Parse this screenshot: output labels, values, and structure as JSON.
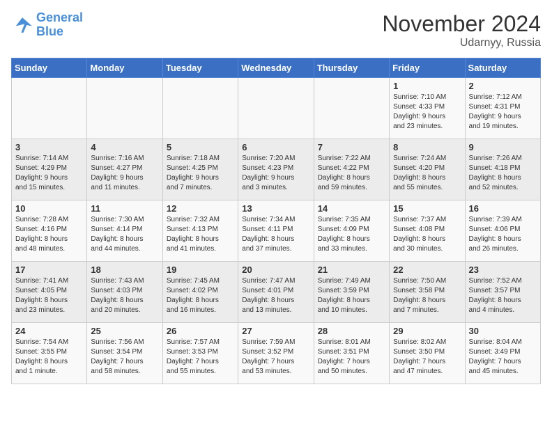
{
  "header": {
    "logo_line1": "General",
    "logo_line2": "Blue",
    "month": "November 2024",
    "location": "Udarnyy, Russia"
  },
  "weekdays": [
    "Sunday",
    "Monday",
    "Tuesday",
    "Wednesday",
    "Thursday",
    "Friday",
    "Saturday"
  ],
  "weeks": [
    [
      {
        "day": "",
        "info": ""
      },
      {
        "day": "",
        "info": ""
      },
      {
        "day": "",
        "info": ""
      },
      {
        "day": "",
        "info": ""
      },
      {
        "day": "",
        "info": ""
      },
      {
        "day": "1",
        "info": "Sunrise: 7:10 AM\nSunset: 4:33 PM\nDaylight: 9 hours\nand 23 minutes."
      },
      {
        "day": "2",
        "info": "Sunrise: 7:12 AM\nSunset: 4:31 PM\nDaylight: 9 hours\nand 19 minutes."
      }
    ],
    [
      {
        "day": "3",
        "info": "Sunrise: 7:14 AM\nSunset: 4:29 PM\nDaylight: 9 hours\nand 15 minutes."
      },
      {
        "day": "4",
        "info": "Sunrise: 7:16 AM\nSunset: 4:27 PM\nDaylight: 9 hours\nand 11 minutes."
      },
      {
        "day": "5",
        "info": "Sunrise: 7:18 AM\nSunset: 4:25 PM\nDaylight: 9 hours\nand 7 minutes."
      },
      {
        "day": "6",
        "info": "Sunrise: 7:20 AM\nSunset: 4:23 PM\nDaylight: 9 hours\nand 3 minutes."
      },
      {
        "day": "7",
        "info": "Sunrise: 7:22 AM\nSunset: 4:22 PM\nDaylight: 8 hours\nand 59 minutes."
      },
      {
        "day": "8",
        "info": "Sunrise: 7:24 AM\nSunset: 4:20 PM\nDaylight: 8 hours\nand 55 minutes."
      },
      {
        "day": "9",
        "info": "Sunrise: 7:26 AM\nSunset: 4:18 PM\nDaylight: 8 hours\nand 52 minutes."
      }
    ],
    [
      {
        "day": "10",
        "info": "Sunrise: 7:28 AM\nSunset: 4:16 PM\nDaylight: 8 hours\nand 48 minutes."
      },
      {
        "day": "11",
        "info": "Sunrise: 7:30 AM\nSunset: 4:14 PM\nDaylight: 8 hours\nand 44 minutes."
      },
      {
        "day": "12",
        "info": "Sunrise: 7:32 AM\nSunset: 4:13 PM\nDaylight: 8 hours\nand 41 minutes."
      },
      {
        "day": "13",
        "info": "Sunrise: 7:34 AM\nSunset: 4:11 PM\nDaylight: 8 hours\nand 37 minutes."
      },
      {
        "day": "14",
        "info": "Sunrise: 7:35 AM\nSunset: 4:09 PM\nDaylight: 8 hours\nand 33 minutes."
      },
      {
        "day": "15",
        "info": "Sunrise: 7:37 AM\nSunset: 4:08 PM\nDaylight: 8 hours\nand 30 minutes."
      },
      {
        "day": "16",
        "info": "Sunrise: 7:39 AM\nSunset: 4:06 PM\nDaylight: 8 hours\nand 26 minutes."
      }
    ],
    [
      {
        "day": "17",
        "info": "Sunrise: 7:41 AM\nSunset: 4:05 PM\nDaylight: 8 hours\nand 23 minutes."
      },
      {
        "day": "18",
        "info": "Sunrise: 7:43 AM\nSunset: 4:03 PM\nDaylight: 8 hours\nand 20 minutes."
      },
      {
        "day": "19",
        "info": "Sunrise: 7:45 AM\nSunset: 4:02 PM\nDaylight: 8 hours\nand 16 minutes."
      },
      {
        "day": "20",
        "info": "Sunrise: 7:47 AM\nSunset: 4:01 PM\nDaylight: 8 hours\nand 13 minutes."
      },
      {
        "day": "21",
        "info": "Sunrise: 7:49 AM\nSunset: 3:59 PM\nDaylight: 8 hours\nand 10 minutes."
      },
      {
        "day": "22",
        "info": "Sunrise: 7:50 AM\nSunset: 3:58 PM\nDaylight: 8 hours\nand 7 minutes."
      },
      {
        "day": "23",
        "info": "Sunrise: 7:52 AM\nSunset: 3:57 PM\nDaylight: 8 hours\nand 4 minutes."
      }
    ],
    [
      {
        "day": "24",
        "info": "Sunrise: 7:54 AM\nSunset: 3:55 PM\nDaylight: 8 hours\nand 1 minute."
      },
      {
        "day": "25",
        "info": "Sunrise: 7:56 AM\nSunset: 3:54 PM\nDaylight: 7 hours\nand 58 minutes."
      },
      {
        "day": "26",
        "info": "Sunrise: 7:57 AM\nSunset: 3:53 PM\nDaylight: 7 hours\nand 55 minutes."
      },
      {
        "day": "27",
        "info": "Sunrise: 7:59 AM\nSunset: 3:52 PM\nDaylight: 7 hours\nand 53 minutes."
      },
      {
        "day": "28",
        "info": "Sunrise: 8:01 AM\nSunset: 3:51 PM\nDaylight: 7 hours\nand 50 minutes."
      },
      {
        "day": "29",
        "info": "Sunrise: 8:02 AM\nSunset: 3:50 PM\nDaylight: 7 hours\nand 47 minutes."
      },
      {
        "day": "30",
        "info": "Sunrise: 8:04 AM\nSunset: 3:49 PM\nDaylight: 7 hours\nand 45 minutes."
      }
    ]
  ]
}
